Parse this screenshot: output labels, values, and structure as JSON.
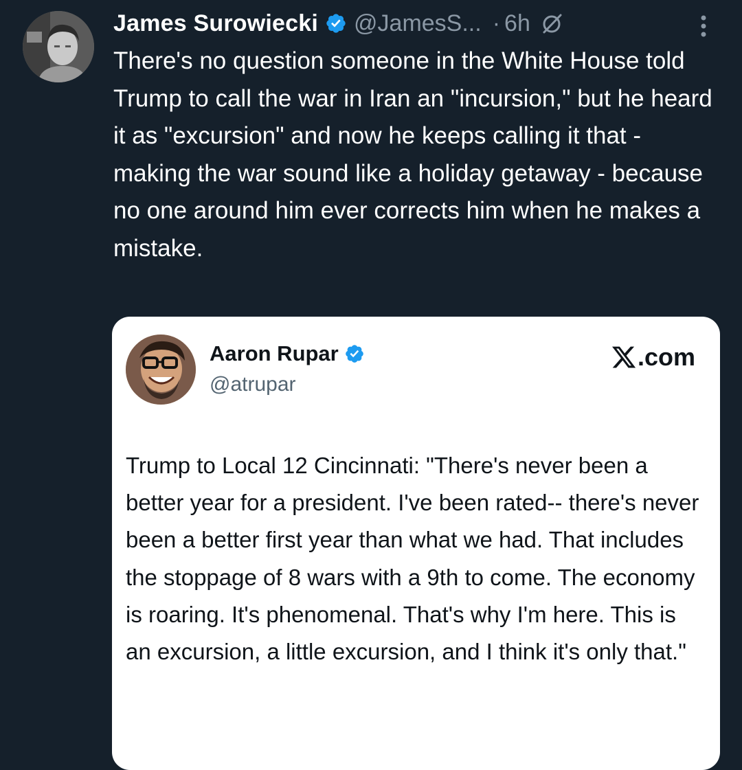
{
  "tweet": {
    "author_name": "James Surowiecki",
    "handle": "@JamesS...",
    "separator": "·",
    "time": "6h",
    "text": "There's no question someone in the White House told Trump to call the war in Iran an \"incursion,\" but he heard it as \"excursion\" and now he keeps calling it that - making the war sound like a holiday getaway - because no one around him ever corrects him when he makes a mistake."
  },
  "quote_card": {
    "name": "Aaron Rupar",
    "handle": "@atrupar",
    "source": ".com",
    "text": "Trump to Local 12 Cincinnati: \"There's never been a better year for a president. I've been rated-- there's never been a better first year than what we had. That includes the stoppage of 8 wars with a 9th to come. The economy is roaring. It's phenomenal. That's why I'm here. This is an excursion, a little excursion, and I think it's only that.\""
  },
  "icons": {
    "verified": "verified-badge-icon",
    "grok": "slash-circle-icon",
    "more": "more-vertical-icon",
    "x_logo": "x-logo-icon"
  },
  "colors": {
    "background": "#15202b",
    "verified": "#1d9bf0",
    "secondary_text": "#8b98a5",
    "card_background": "#ffffff"
  }
}
